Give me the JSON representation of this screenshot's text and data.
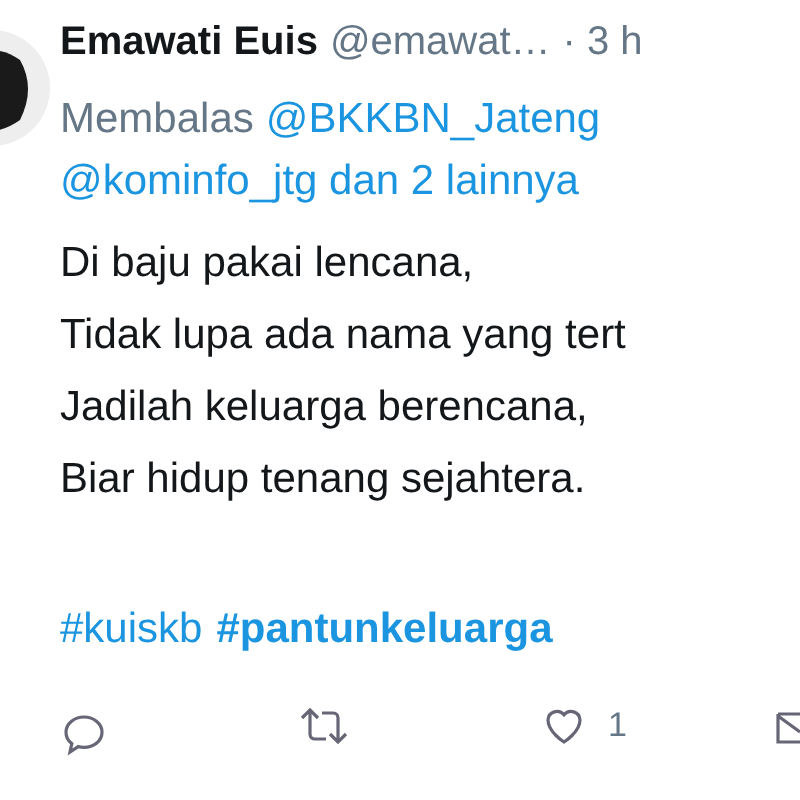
{
  "tweet": {
    "author": {
      "name": "Emawati Euis",
      "handle": "@emawat…",
      "time": "· 3 h"
    },
    "reply_to": {
      "prefix": "Membalas",
      "mentions": [
        "@BKKBN_Jateng",
        "@kominfo_jtg dan 2 lainnya"
      ]
    },
    "lines": [
      "Di baju pakai lencana,",
      "Tidak lupa ada nama yang tert",
      "Jadilah keluarga berencana,",
      "Biar hidup tenang sejahtera."
    ],
    "hashtags": [
      {
        "text": "#kuiskb",
        "bold": false
      },
      {
        "text": "#pantunkeluarga",
        "bold": true
      }
    ],
    "actions": [
      {
        "kind": "reply"
      },
      {
        "kind": "retweet"
      },
      {
        "kind": "like",
        "count": "1"
      },
      {
        "kind": "share"
      }
    ]
  }
}
